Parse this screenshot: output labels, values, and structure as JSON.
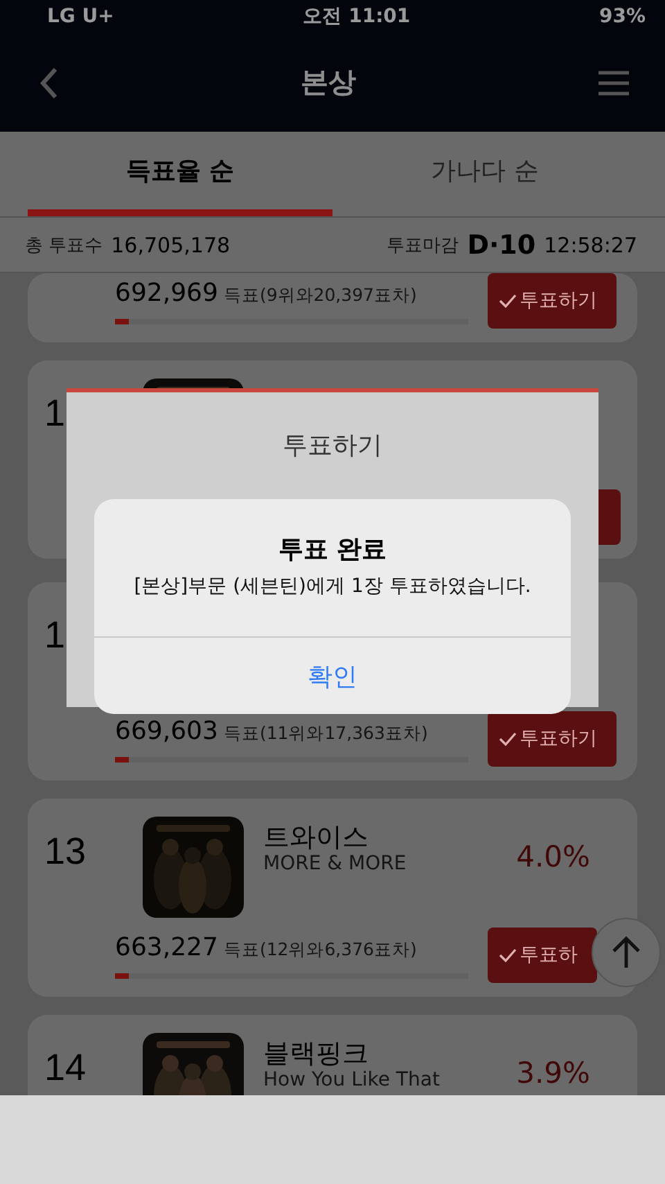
{
  "status_bar": {
    "carrier": "LG U+",
    "time": "오전 11:01",
    "battery": "93%"
  },
  "header": {
    "title": "본상"
  },
  "tabs": [
    {
      "label": "득표율 순",
      "selected": true
    },
    {
      "label": "가나다 순",
      "selected": false
    }
  ],
  "summary": {
    "total_label": "총 투표수",
    "total": "16,705,178",
    "deadline_label": "투표마감",
    "d_day": "D·10",
    "countdown": "12:58:27"
  },
  "entries": [
    {
      "votes": "692,969",
      "vote_note": "득표(9위와20,397표차)",
      "level": 0.04,
      "button": "투표하기"
    },
    {
      "rank": "1"
    },
    {
      "rank": "1",
      "votes": "669,603",
      "vote_note": "득표(11위와17,363표차)",
      "level": 0.04,
      "button": "투표하기"
    },
    {
      "rank": "13",
      "name": "트와이스",
      "album": "MORE & MORE",
      "percent": "4.0%",
      "votes": "663,227",
      "vote_note": "득표(12위와6,376표차)",
      "level": 0.04,
      "button": "투표하"
    },
    {
      "rank": "14",
      "name": "블랙핑크",
      "album": "How You Like That",
      "percent": "3.9%"
    }
  ],
  "dialog": {
    "title": "투표하기"
  },
  "alert": {
    "title": "투표 완료",
    "message": "[본상]부문 (세븐틴)에게 1장 투표하였습니다.",
    "button": "확인"
  }
}
